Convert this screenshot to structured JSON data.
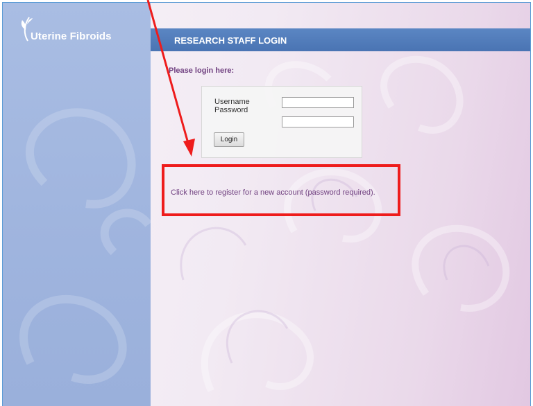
{
  "app": {
    "logo_text": "Uterine Fibroids",
    "logo_icon": "wheat-leaf-icon"
  },
  "header": {
    "title": "RESEARCH STAFF LOGIN"
  },
  "main": {
    "prompt": "Please login here:",
    "login_form": {
      "username_label": "Username",
      "password_label": "Password",
      "username_value": "",
      "password_value": "",
      "login_button": "Login"
    },
    "register_link": "Click here to register for a new account (password required)."
  },
  "annotation": {
    "color": "#ee1c1c",
    "type": "arrow-and-box"
  },
  "colors": {
    "header": "#4f7bbb",
    "sidebar": "#a3b8e0",
    "accent_text": "#6f3f7f"
  }
}
